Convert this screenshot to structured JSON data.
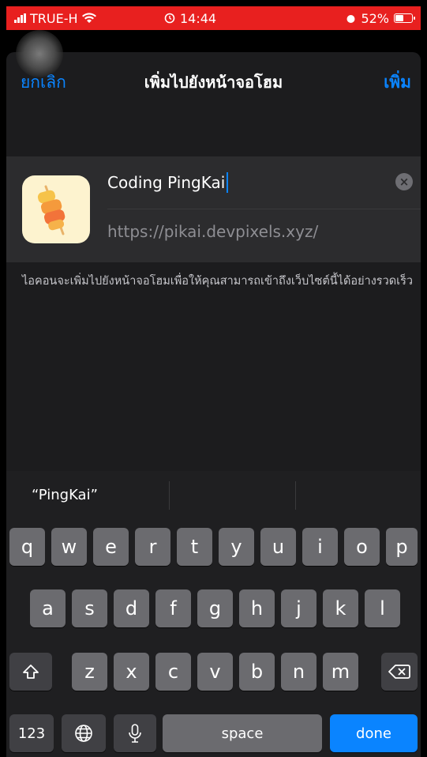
{
  "status_bar": {
    "carrier": "TRUE-H",
    "time": "14:44",
    "battery": "52%"
  },
  "nav": {
    "cancel_label": "ยกเลิก",
    "title": "เพิ่มไปยังหน้าจอโฮม",
    "add_label": "เพิ่ม"
  },
  "bookmark": {
    "name": "Coding PingKai",
    "url": "https://pikai.devpixels.xyz/"
  },
  "hint_text": "ไอคอนจะเพิ่มไปยังหน้าจอโฮมเพื่อให้คุณสามารถเข้าถึงเว็บไซต์นี้ได้อย่างรวดเร็ว",
  "keyboard": {
    "suggestions": [
      "“PingKai”",
      "",
      ""
    ],
    "row1": [
      "q",
      "w",
      "e",
      "r",
      "t",
      "y",
      "u",
      "i",
      "o",
      "p"
    ],
    "row2": [
      "a",
      "s",
      "d",
      "f",
      "g",
      "h",
      "j",
      "k",
      "l"
    ],
    "row3": [
      "z",
      "x",
      "c",
      "v",
      "b",
      "n",
      "m"
    ],
    "numbers_label": "123",
    "space_label": "space",
    "done_label": "done"
  },
  "colors": {
    "accent": "#0a84ff",
    "status_bar": "#e8201f",
    "icon_bg": "#fdf3cf"
  }
}
